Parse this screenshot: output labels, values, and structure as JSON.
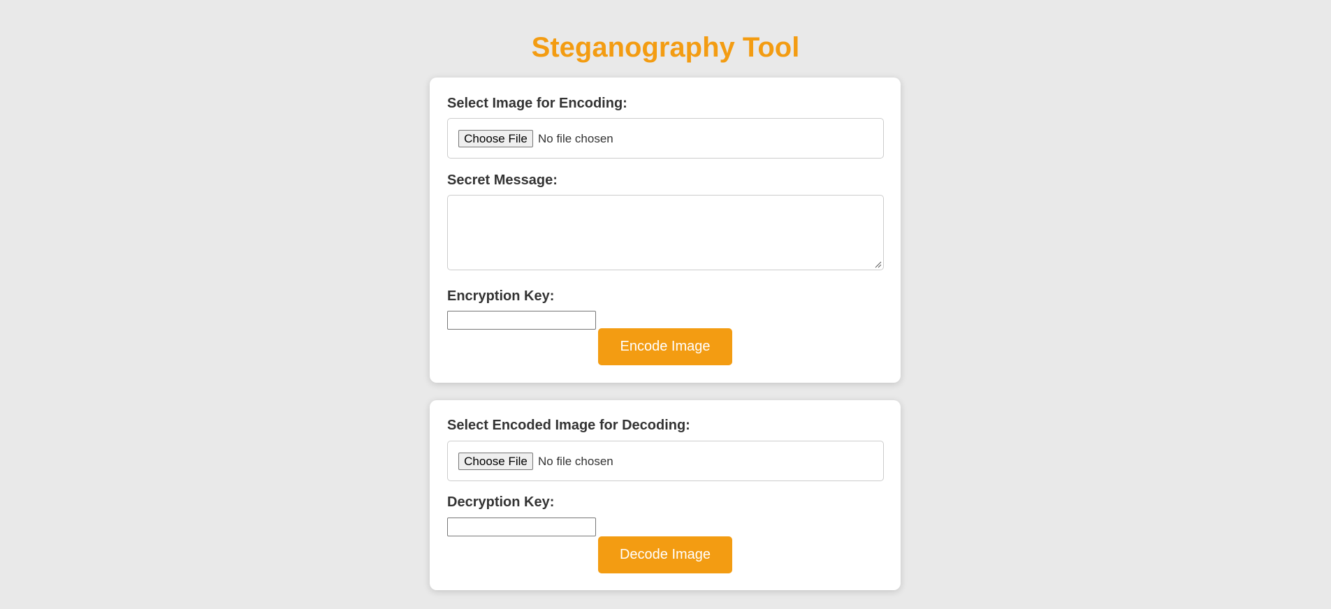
{
  "page": {
    "title": "Steganography Tool",
    "accent_color": "#f39c12",
    "background_color": "#e9e9e9"
  },
  "encode_section": {
    "image_label": "Select Image for Encoding:",
    "file_button_label": "Choose File",
    "file_status": "No file chosen",
    "message_label": "Secret Message:",
    "message_value": "",
    "key_label": "Encryption Key:",
    "key_value": "",
    "submit_label": "Encode Image"
  },
  "decode_section": {
    "image_label": "Select Encoded Image for Decoding:",
    "file_button_label": "Choose File",
    "file_status": "No file chosen",
    "key_label": "Decryption Key:",
    "key_value": "",
    "submit_label": "Decode Image"
  }
}
